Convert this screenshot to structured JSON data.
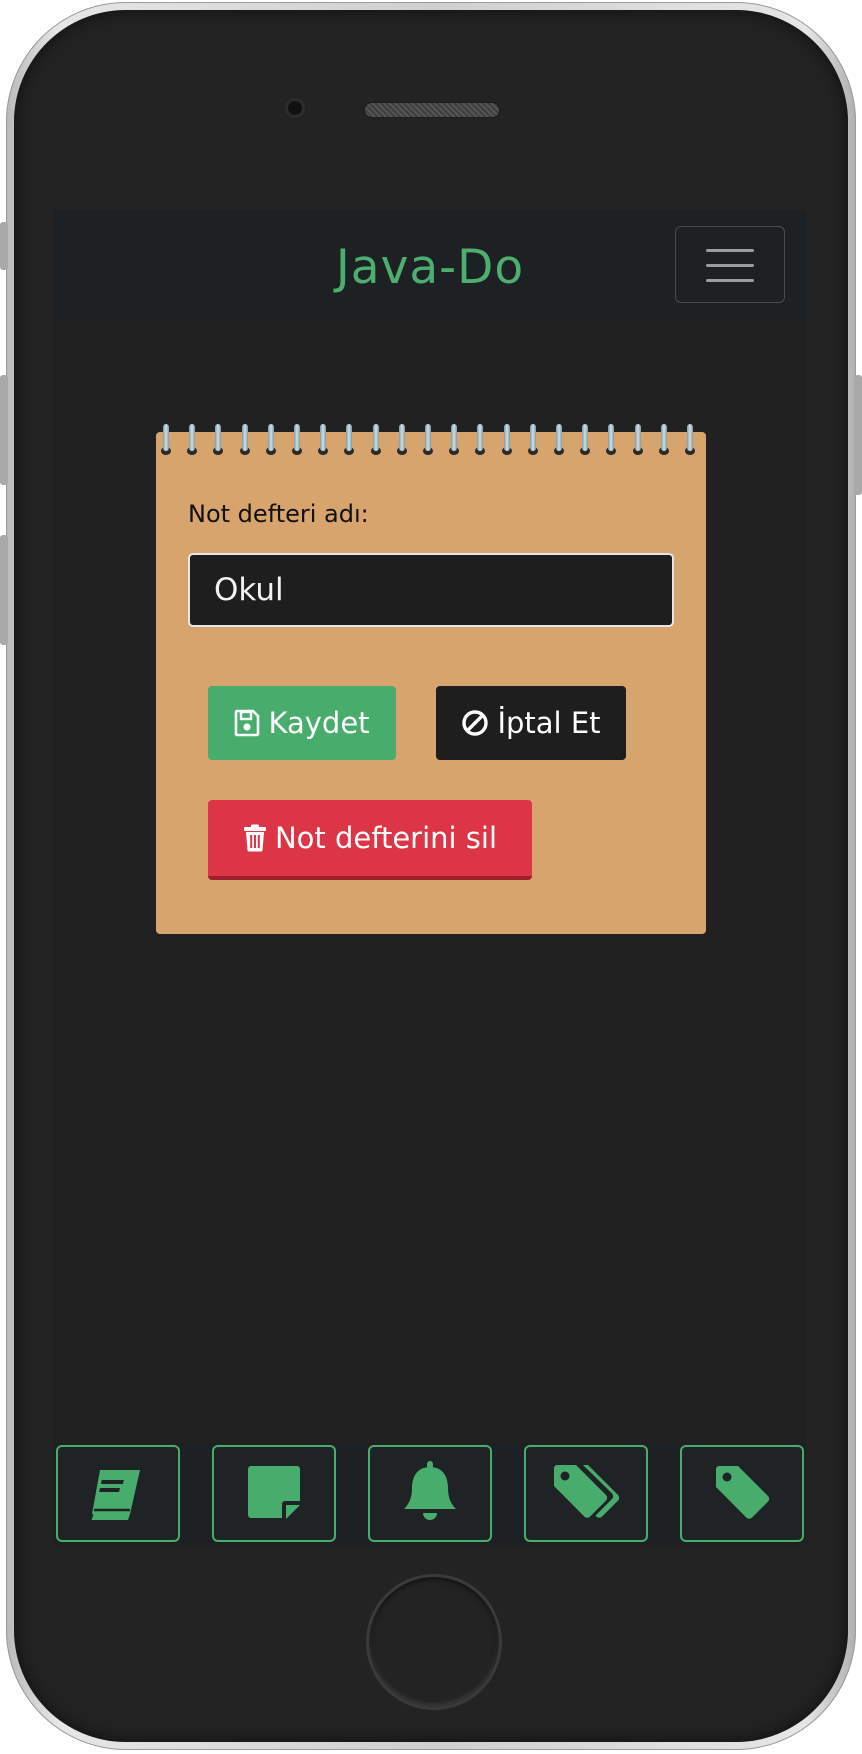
{
  "app": {
    "brand": "Java-Do"
  },
  "form": {
    "label": "Not defteri adı:",
    "notebook_name_value": "Okul",
    "save_label": "Kaydet",
    "cancel_label": "İptal Et",
    "delete_label": "Not defterini sil"
  },
  "bottom_nav": {
    "items": [
      {
        "icon": "book-icon"
      },
      {
        "icon": "sticky-note-icon"
      },
      {
        "icon": "bell-icon"
      },
      {
        "icon": "tags-icon"
      },
      {
        "icon": "tag-icon"
      }
    ]
  },
  "colors": {
    "accent": "#48ad6c",
    "notepad": "#d7a46d",
    "danger": "#dc3545",
    "background": "#212121",
    "navbar": "#1e2124"
  }
}
